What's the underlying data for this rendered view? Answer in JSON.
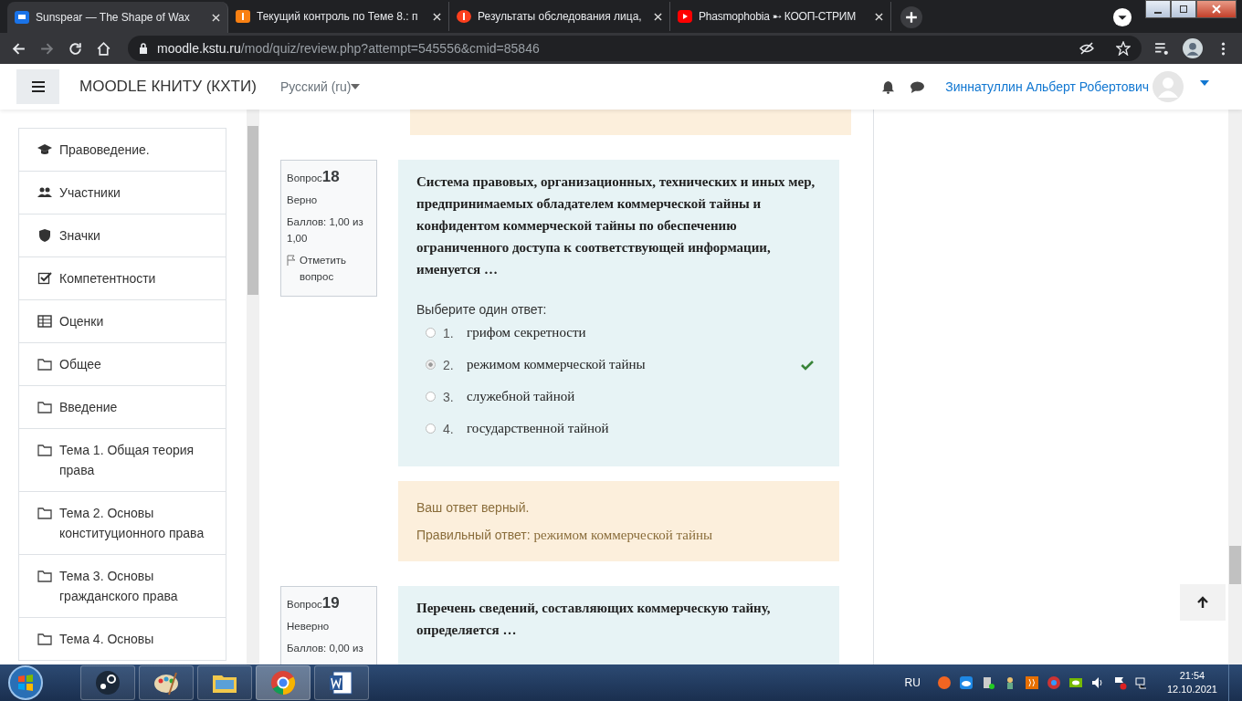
{
  "browser": {
    "tabs": [
      {
        "title": "Sunspear — The Shape of Wax",
        "selected": true
      },
      {
        "title": "Текущий контроль по Теме 8.: п",
        "selected": false
      },
      {
        "title": "Результаты обследования лица,",
        "selected": false
      },
      {
        "title": "Phasmophobia ➸ КООП-СТРИМ",
        "selected": false
      }
    ],
    "url_host": "moodle.kstu.ru",
    "url_path": "/mod/quiz/review.php?attempt=545556&cmid=85846"
  },
  "header": {
    "site_name": "MOODLE КНИТУ (КХТИ)",
    "language": "Русский (ru)",
    "user_name": "Зиннатуллин Альберт Робертович"
  },
  "sidebar": {
    "items": [
      {
        "label": "Правоведение."
      },
      {
        "label": "Участники"
      },
      {
        "label": "Значки"
      },
      {
        "label": "Компетентности"
      },
      {
        "label": "Оценки"
      },
      {
        "label": "Общее"
      },
      {
        "label": "Введение"
      },
      {
        "label": "Тема 1. Общая теория права"
      },
      {
        "label": "Тема 2. Основы конституционного права"
      },
      {
        "label": "Тема 3. Основы гражданского права"
      },
      {
        "label": "Тема 4. Основы"
      }
    ]
  },
  "questions": [
    {
      "label": "Вопрос",
      "number": "18",
      "state": "Верно",
      "grade": "Баллов: 1,00 из 1,00",
      "flag": "Отметить вопрос",
      "text": "Система правовых, организационных, технических и иных мер, предпринимаемых обладателем коммерческой тайны и конфидентом коммерческой тайны по обеспечению ограниченного доступа к соответствующей информации, именуется …",
      "prompt": "Выберите один ответ:",
      "answers": [
        {
          "number": "1.",
          "text": "грифом секретности",
          "selected": false,
          "correct": false
        },
        {
          "number": "2.",
          "text": "режимом коммерческой тайны",
          "selected": true,
          "correct": true
        },
        {
          "number": "3.",
          "text": "служебной тайной",
          "selected": false,
          "correct": false
        },
        {
          "number": "4.",
          "text": "государственной тайной",
          "selected": false,
          "correct": false
        }
      ],
      "feedback": "Ваш ответ верный.",
      "right_answer_label": "Правильный ответ:",
      "right_answer": "режимом коммерческой тайны"
    },
    {
      "label": "Вопрос",
      "number": "19",
      "state": "Неверно",
      "grade": "Баллов: 0,00 из",
      "text": "Перечень сведений, составляющих коммерческую тайну, определяется …"
    }
  ],
  "taskbar": {
    "apps": [
      {
        "selected": false
      },
      {
        "selected": false
      },
      {
        "selected": false
      },
      {
        "selected": true
      },
      {
        "selected": false
      }
    ],
    "language": "RU",
    "time": "21:54",
    "date": "12.10.2021"
  }
}
